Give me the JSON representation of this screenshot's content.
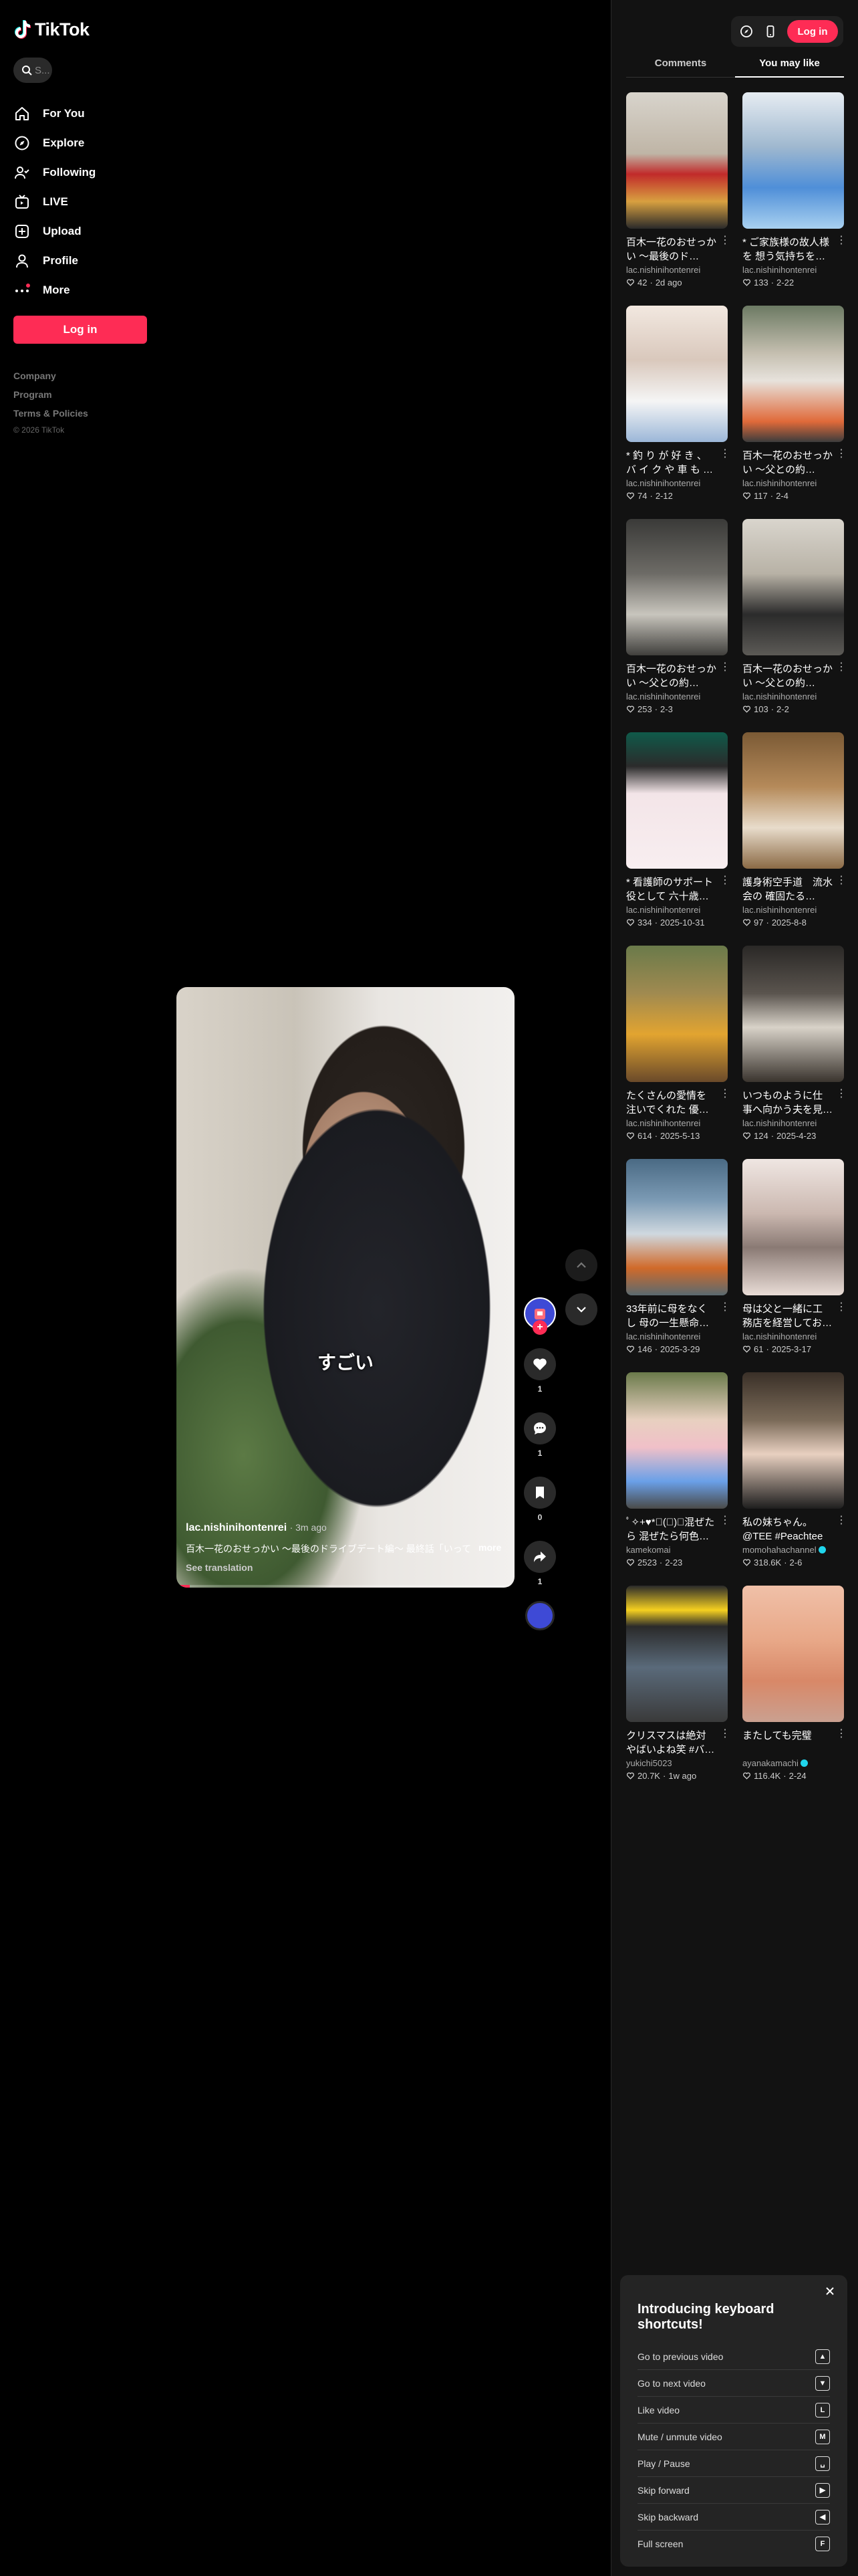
{
  "app": {
    "name": "TikTok",
    "brand_color": "#fe2c55"
  },
  "sidebar": {
    "search_placeholder": "S...",
    "items": [
      {
        "label": "For You",
        "icon": "home-icon"
      },
      {
        "label": "Explore",
        "icon": "compass-icon"
      },
      {
        "label": "Following",
        "icon": "following-icon"
      },
      {
        "label": "LIVE",
        "icon": "live-icon"
      },
      {
        "label": "Upload",
        "icon": "upload-icon"
      },
      {
        "label": "Profile",
        "icon": "profile-icon"
      },
      {
        "label": "More",
        "icon": "more-icon"
      }
    ],
    "login_label": "Log in",
    "footer": [
      "Company",
      "Program",
      "Terms & Policies"
    ],
    "copyright": "© 2026 TikTok"
  },
  "video": {
    "subtitle": "すごい",
    "author": "lac.nishinihontenrei",
    "time": "· 3m ago",
    "description": "百木一花のおせっかい 〜最後のドライブデート編〜 最終話「いって",
    "more_label": "more",
    "translate_label": "See translation",
    "progress": 0.04,
    "likes": "1",
    "comments": "1",
    "saves": "0",
    "shares": "1"
  },
  "panel": {
    "login_label": "Log in",
    "tabs": [
      {
        "label": "Comments",
        "active": false
      },
      {
        "label": "You may like",
        "active": true
      }
    ],
    "cards": [
      {
        "title": "百木一花のおせっかい 〜最後のド…",
        "author": "lac.nishinihontenrei",
        "likes": "42",
        "date": "2d ago",
        "verified": false
      },
      {
        "title": "* ご家族様の故人様を 想う気持ちを…",
        "author": "lac.nishinihontenrei",
        "likes": "133",
        "date": "2-22",
        "verified": false
      },
      {
        "title": "* 釣 り が 好 き 、 バ イ ク や 車 も …",
        "author": "lac.nishinihontenrei",
        "likes": "74",
        "date": "2-12",
        "verified": false
      },
      {
        "title": "百木一花のおせっかい 〜父との約…",
        "author": "lac.nishinihontenrei",
        "likes": "117",
        "date": "2-4",
        "verified": false
      },
      {
        "title": "百木一花のおせっかい 〜父との約…",
        "author": "lac.nishinihontenrei",
        "likes": "253",
        "date": "2-3",
        "verified": false
      },
      {
        "title": "百木一花のおせっかい 〜父との約…",
        "author": "lac.nishinihontenrei",
        "likes": "103",
        "date": "2-2",
        "verified": false
      },
      {
        "title": "* 看護師のサポート 役として 六十歳…",
        "author": "lac.nishinihontenrei",
        "likes": "334",
        "date": "2025-10-31",
        "verified": false
      },
      {
        "title": "護身術空手道　流水会の 確固たる…",
        "author": "lac.nishinihontenrei",
        "likes": "97",
        "date": "2025-8-8",
        "verified": false
      },
      {
        "title": "たくさんの愛情を 注いでくれた 優…",
        "author": "lac.nishinihontenrei",
        "likes": "614",
        "date": "2025-5-13",
        "verified": false
      },
      {
        "title": "いつものように仕 事へ向かう夫を見…",
        "author": "lac.nishinihontenrei",
        "likes": "124",
        "date": "2025-4-23",
        "verified": false
      },
      {
        "title": "33年前に母をなく し 母の一生懸命…",
        "author": "lac.nishinihontenrei",
        "likes": "146",
        "date": "2025-3-29",
        "verified": false
      },
      {
        "title": "母は父と一緒に工 務店を経営してお…",
        "author": "lac.nishinihontenrei",
        "likes": "61",
        "date": "2025-3-17",
        "verified": false
      },
      {
        "title": "ﾟ✧+♥︎*ﾟ(ﾟ)ﾟ混ぜたら 混ぜたら何色な…",
        "author": "kamekomai",
        "likes": "2523",
        "date": "2-23",
        "verified": false
      },
      {
        "title": "私の妹ちゃん。 @TEE #Peachtee",
        "author": "momohahachannel",
        "likes": "318.6K",
        "date": "2-6",
        "verified": true
      },
      {
        "title": "クリスマスは絶対 やばいよね笑 #バ…",
        "author": "yukichi5023",
        "likes": "20.7K",
        "date": "1w ago",
        "verified": false
      },
      {
        "title": "またしても完璧",
        "author": "ayanakamachi",
        "likes": "116.4K",
        "date": "2-24",
        "verified": true
      }
    ]
  },
  "shortcuts": {
    "title": "Introducing keyboard shortcuts!",
    "items": [
      {
        "label": "Go to previous video",
        "key": "▲"
      },
      {
        "label": "Go to next video",
        "key": "▼"
      },
      {
        "label": "Like video",
        "key": "L"
      },
      {
        "label": "Mute / unmute video",
        "key": "M"
      },
      {
        "label": "Play / Pause",
        "key": "␣"
      },
      {
        "label": "Skip forward",
        "key": "▶"
      },
      {
        "label": "Skip backward",
        "key": "◀"
      },
      {
        "label": "Full screen",
        "key": "F"
      }
    ]
  }
}
